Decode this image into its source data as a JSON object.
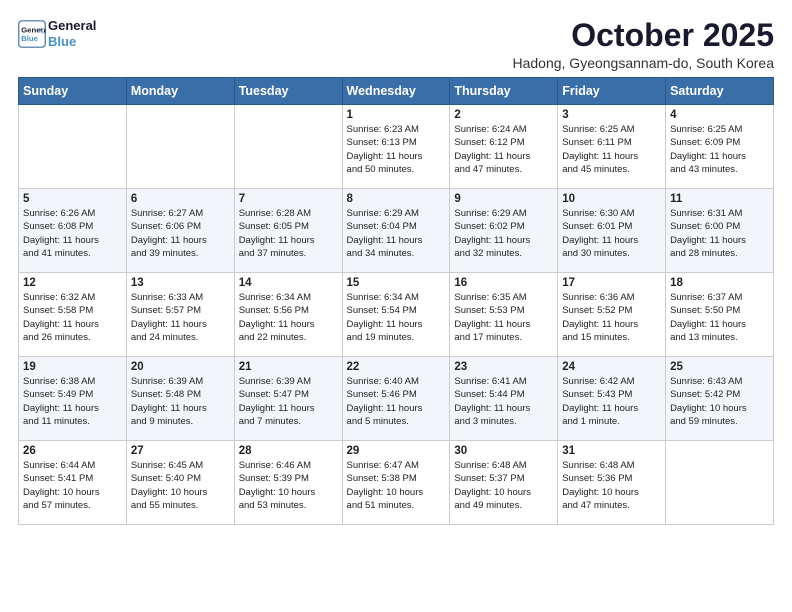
{
  "header": {
    "logo_line1": "General",
    "logo_line2": "Blue",
    "title": "October 2025",
    "subtitle": "Hadong, Gyeongsannam-do, South Korea"
  },
  "weekdays": [
    "Sunday",
    "Monday",
    "Tuesday",
    "Wednesday",
    "Thursday",
    "Friday",
    "Saturday"
  ],
  "weeks": [
    [
      {
        "day": "",
        "info": ""
      },
      {
        "day": "",
        "info": ""
      },
      {
        "day": "",
        "info": ""
      },
      {
        "day": "1",
        "info": "Sunrise: 6:23 AM\nSunset: 6:13 PM\nDaylight: 11 hours\nand 50 minutes."
      },
      {
        "day": "2",
        "info": "Sunrise: 6:24 AM\nSunset: 6:12 PM\nDaylight: 11 hours\nand 47 minutes."
      },
      {
        "day": "3",
        "info": "Sunrise: 6:25 AM\nSunset: 6:11 PM\nDaylight: 11 hours\nand 45 minutes."
      },
      {
        "day": "4",
        "info": "Sunrise: 6:25 AM\nSunset: 6:09 PM\nDaylight: 11 hours\nand 43 minutes."
      }
    ],
    [
      {
        "day": "5",
        "info": "Sunrise: 6:26 AM\nSunset: 6:08 PM\nDaylight: 11 hours\nand 41 minutes."
      },
      {
        "day": "6",
        "info": "Sunrise: 6:27 AM\nSunset: 6:06 PM\nDaylight: 11 hours\nand 39 minutes."
      },
      {
        "day": "7",
        "info": "Sunrise: 6:28 AM\nSunset: 6:05 PM\nDaylight: 11 hours\nand 37 minutes."
      },
      {
        "day": "8",
        "info": "Sunrise: 6:29 AM\nSunset: 6:04 PM\nDaylight: 11 hours\nand 34 minutes."
      },
      {
        "day": "9",
        "info": "Sunrise: 6:29 AM\nSunset: 6:02 PM\nDaylight: 11 hours\nand 32 minutes."
      },
      {
        "day": "10",
        "info": "Sunrise: 6:30 AM\nSunset: 6:01 PM\nDaylight: 11 hours\nand 30 minutes."
      },
      {
        "day": "11",
        "info": "Sunrise: 6:31 AM\nSunset: 6:00 PM\nDaylight: 11 hours\nand 28 minutes."
      }
    ],
    [
      {
        "day": "12",
        "info": "Sunrise: 6:32 AM\nSunset: 5:58 PM\nDaylight: 11 hours\nand 26 minutes."
      },
      {
        "day": "13",
        "info": "Sunrise: 6:33 AM\nSunset: 5:57 PM\nDaylight: 11 hours\nand 24 minutes."
      },
      {
        "day": "14",
        "info": "Sunrise: 6:34 AM\nSunset: 5:56 PM\nDaylight: 11 hours\nand 22 minutes."
      },
      {
        "day": "15",
        "info": "Sunrise: 6:34 AM\nSunset: 5:54 PM\nDaylight: 11 hours\nand 19 minutes."
      },
      {
        "day": "16",
        "info": "Sunrise: 6:35 AM\nSunset: 5:53 PM\nDaylight: 11 hours\nand 17 minutes."
      },
      {
        "day": "17",
        "info": "Sunrise: 6:36 AM\nSunset: 5:52 PM\nDaylight: 11 hours\nand 15 minutes."
      },
      {
        "day": "18",
        "info": "Sunrise: 6:37 AM\nSunset: 5:50 PM\nDaylight: 11 hours\nand 13 minutes."
      }
    ],
    [
      {
        "day": "19",
        "info": "Sunrise: 6:38 AM\nSunset: 5:49 PM\nDaylight: 11 hours\nand 11 minutes."
      },
      {
        "day": "20",
        "info": "Sunrise: 6:39 AM\nSunset: 5:48 PM\nDaylight: 11 hours\nand 9 minutes."
      },
      {
        "day": "21",
        "info": "Sunrise: 6:39 AM\nSunset: 5:47 PM\nDaylight: 11 hours\nand 7 minutes."
      },
      {
        "day": "22",
        "info": "Sunrise: 6:40 AM\nSunset: 5:46 PM\nDaylight: 11 hours\nand 5 minutes."
      },
      {
        "day": "23",
        "info": "Sunrise: 6:41 AM\nSunset: 5:44 PM\nDaylight: 11 hours\nand 3 minutes."
      },
      {
        "day": "24",
        "info": "Sunrise: 6:42 AM\nSunset: 5:43 PM\nDaylight: 11 hours\nand 1 minute."
      },
      {
        "day": "25",
        "info": "Sunrise: 6:43 AM\nSunset: 5:42 PM\nDaylight: 10 hours\nand 59 minutes."
      }
    ],
    [
      {
        "day": "26",
        "info": "Sunrise: 6:44 AM\nSunset: 5:41 PM\nDaylight: 10 hours\nand 57 minutes."
      },
      {
        "day": "27",
        "info": "Sunrise: 6:45 AM\nSunset: 5:40 PM\nDaylight: 10 hours\nand 55 minutes."
      },
      {
        "day": "28",
        "info": "Sunrise: 6:46 AM\nSunset: 5:39 PM\nDaylight: 10 hours\nand 53 minutes."
      },
      {
        "day": "29",
        "info": "Sunrise: 6:47 AM\nSunset: 5:38 PM\nDaylight: 10 hours\nand 51 minutes."
      },
      {
        "day": "30",
        "info": "Sunrise: 6:48 AM\nSunset: 5:37 PM\nDaylight: 10 hours\nand 49 minutes."
      },
      {
        "day": "31",
        "info": "Sunrise: 6:48 AM\nSunset: 5:36 PM\nDaylight: 10 hours\nand 47 minutes."
      },
      {
        "day": "",
        "info": ""
      }
    ]
  ]
}
